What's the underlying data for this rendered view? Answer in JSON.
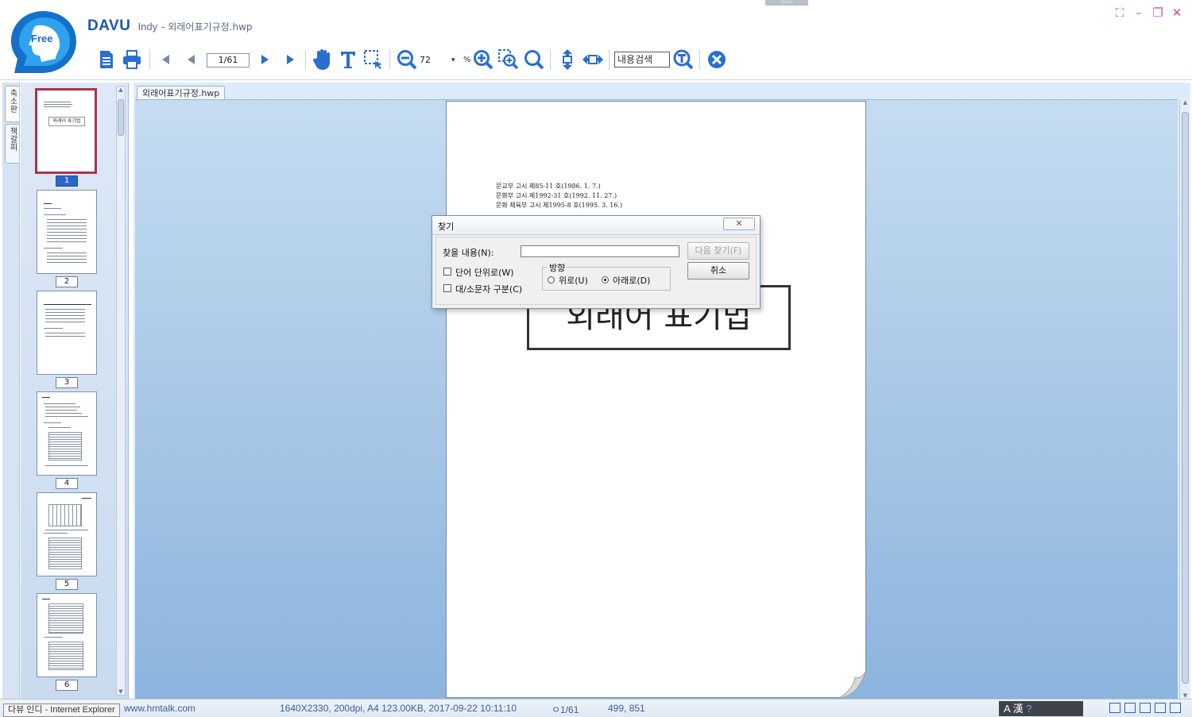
{
  "header": {
    "brand": "DAVU",
    "edition": "Indy",
    "file_title": " - 외래어표기규정.hwp",
    "logo_text": "Free",
    "handle_text": "shend"
  },
  "toolbar": {
    "page_indicator": "1/61",
    "zoom_value": "72",
    "zoom_unit": "%",
    "search_placeholder": "내용검색",
    "icons": [
      "document-icon",
      "print-icon",
      "first-page-icon",
      "prev-page-icon",
      "next-page-icon",
      "last-page-icon",
      "hand-tool-icon",
      "text-select-icon",
      "area-select-icon",
      "zoom-out-icon",
      "zoom-in-icon",
      "zoom-area-icon",
      "zoom-fit-icon",
      "fit-height-icon",
      "fit-width-icon",
      "search-text-icon",
      "close-circle-icon"
    ]
  },
  "side_tabs": [
    "축소판",
    "책갈피"
  ],
  "thumbnails": [
    {
      "label": "1",
      "selected": true,
      "title_text": "외래어 표기법"
    },
    {
      "label": "2",
      "selected": false
    },
    {
      "label": "3",
      "selected": false
    },
    {
      "label": "4",
      "selected": false
    },
    {
      "label": "5",
      "selected": false
    },
    {
      "label": "6",
      "selected": false
    }
  ],
  "document": {
    "tab_label": "외래어표기규정.hwp",
    "decrees": [
      "문교부 고시 제85-11 호(1986. 1. 7.)",
      "문화부 고시 제1992-31 호(1992. 11. 27.)",
      "문화 체육부 고시 제1995-8 호(1995. 3. 16.)"
    ],
    "title": "외래어 표기법"
  },
  "find_dialog": {
    "title": "찾기",
    "find_label": "찾을 내용(N):",
    "find_value": "",
    "find_next_button": "다음 찾기(F)",
    "cancel_button": "취소",
    "whole_word_label": "단어 단위로(W)",
    "match_case_label": "대/소문자 구분(C)",
    "direction_label": "방향",
    "direction_up_label": "위로(U)",
    "direction_down_label": "아래로(D)",
    "direction_selected": "down"
  },
  "statusbar": {
    "ie_caption": "다뷰 인디 - Internet Explorer",
    "site": "www.hmtalk.com",
    "doc_info": "1640X2330, 200dpi, A4 123.00KB, 2017-09-22 10:11:10",
    "page_info": "ㅇ1/61",
    "coords": "499, 851",
    "ime_text": "A 漢"
  },
  "colors": {
    "brand_blue": "#1f56b0",
    "selected_thumb_border": "#a8334e",
    "window_control_pink": "#e04b9a",
    "close_circle_blue": "#2a6fd0"
  }
}
